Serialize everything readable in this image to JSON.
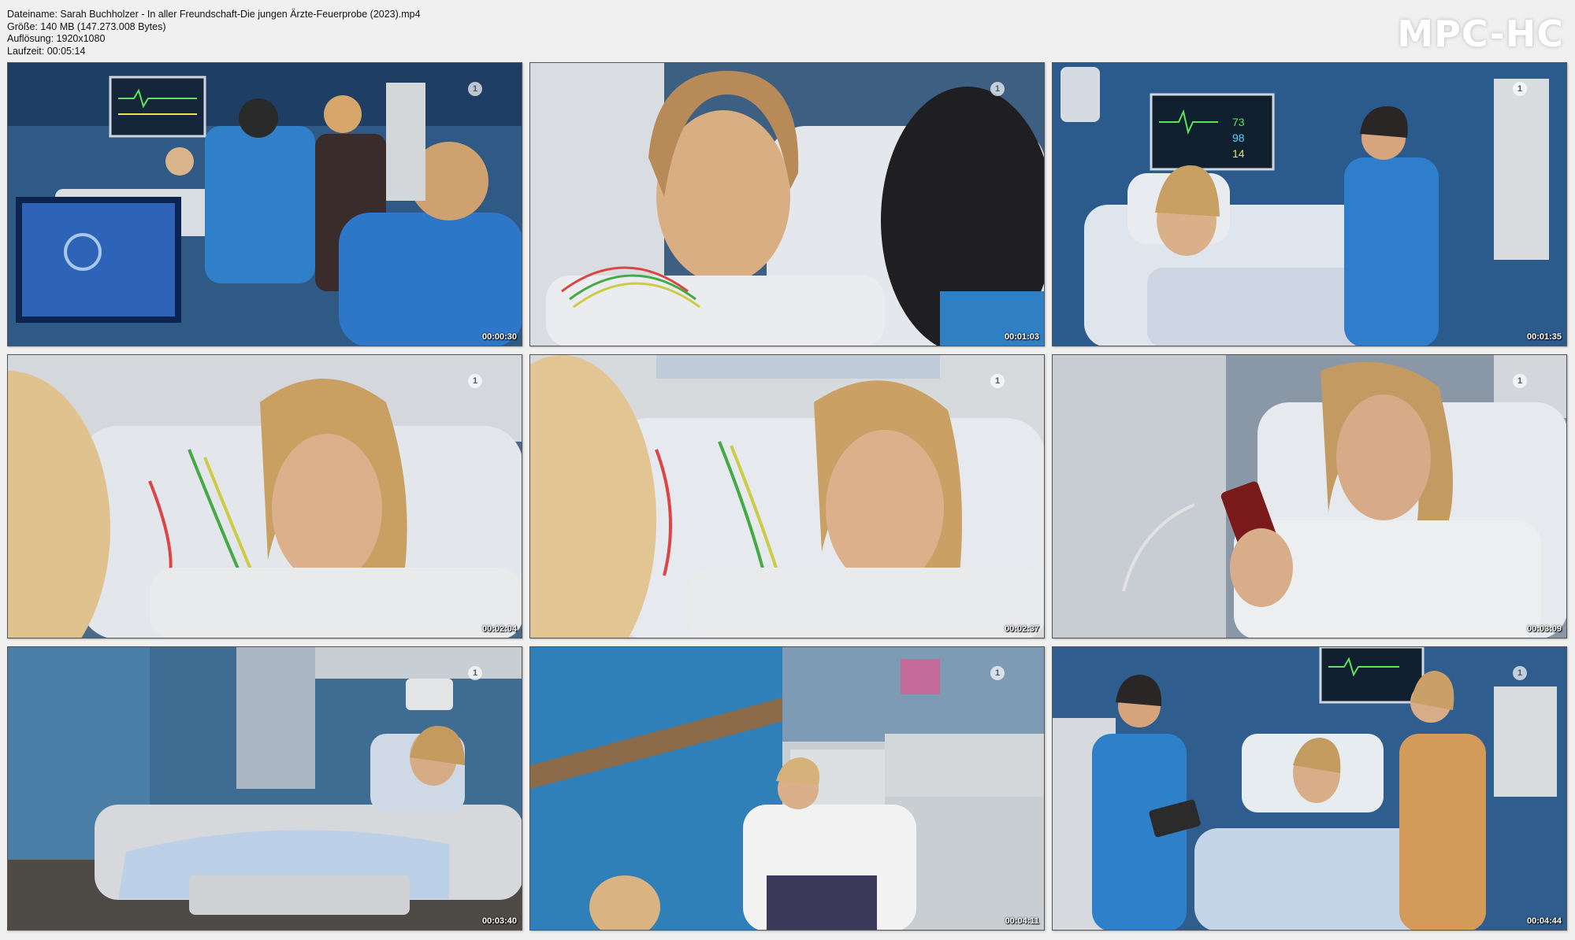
{
  "info": {
    "filename": "Dateiname: Sarah Buchholzer - In aller Freundschaft-Die jungen Ärzte-Feuerprobe (2023).mp4",
    "size": "Größe: 140 MB (147.273.008 Bytes)",
    "resolution": "Auflösung: 1920x1080",
    "duration": "Laufzeit: 00:05:14"
  },
  "logo": "MPC-HC",
  "channel_logo": "1",
  "thumbnails": [
    {
      "time": "00:00:30"
    },
    {
      "time": "00:01:03"
    },
    {
      "time": "00:01:35"
    },
    {
      "time": "00:02:04"
    },
    {
      "time": "00:02:37"
    },
    {
      "time": "00:03:09"
    },
    {
      "time": "00:03:40"
    },
    {
      "time": "00:04:11"
    },
    {
      "time": "00:04:44"
    }
  ]
}
